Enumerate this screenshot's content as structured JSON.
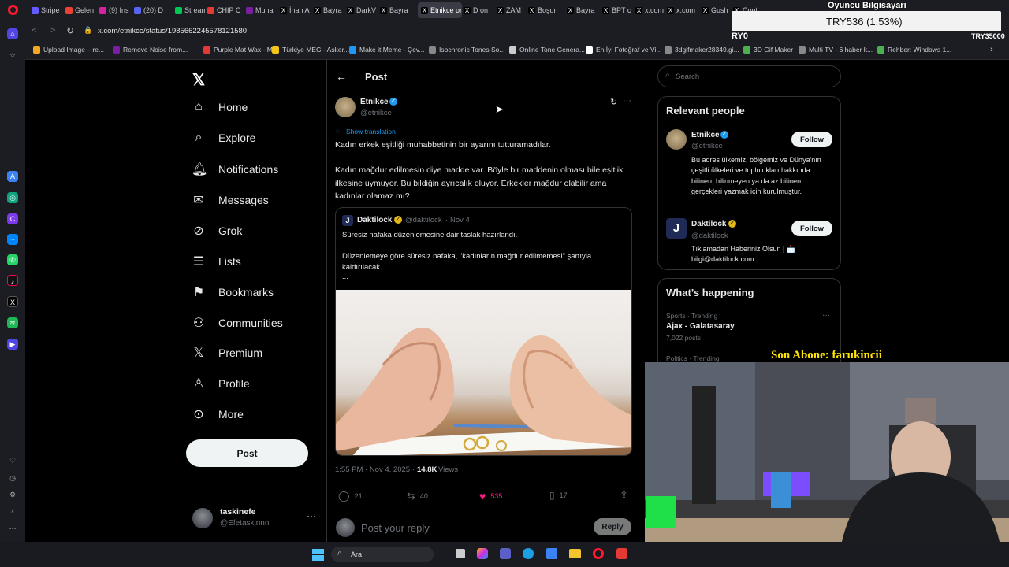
{
  "browser": {
    "tabs": [
      {
        "label": "Stripe",
        "color": "#635bff"
      },
      {
        "label": "Gelen",
        "color": "#ea4335"
      },
      {
        "label": "(9) Ins",
        "color": "#d6249f"
      },
      {
        "label": "(20) D",
        "color": "#5865f2"
      },
      {
        "label": "Stream",
        "color": "#00c853"
      },
      {
        "label": "CHIP C",
        "color": "#e53935"
      },
      {
        "label": "Muha",
        "color": "#7b1fa2"
      },
      {
        "label": "İnan A",
        "color": "#000000"
      },
      {
        "label": "Bayra",
        "color": "#000000"
      },
      {
        "label": "DarkV",
        "color": "#000000"
      },
      {
        "label": "Bayra",
        "color": "#000000"
      },
      {
        "label": "Etnikce on",
        "color": "#000000"
      },
      {
        "label": "D on",
        "color": "#000000"
      },
      {
        "label": "ZAM",
        "color": "#000000"
      },
      {
        "label": "Boşun",
        "color": "#000000"
      },
      {
        "label": "Bayra",
        "color": "#000000"
      },
      {
        "label": "BPT c",
        "color": "#000000"
      },
      {
        "label": "x.com",
        "color": "#000000"
      },
      {
        "label": "x.com",
        "color": "#000000"
      },
      {
        "label": "Gush",
        "color": "#000000"
      },
      {
        "label": "Confi",
        "color": "#000000"
      }
    ],
    "url": "x.com/etnikce/status/1985662245578121580",
    "bookmarks": [
      {
        "label": "Upload Image – re...",
        "color": "#f5a623"
      },
      {
        "label": "Remove Noise from...",
        "color": "#7b1fa2"
      },
      {
        "label": "Purple Mat Wax - M...",
        "color": "#e53935"
      },
      {
        "label": "Türkiye MEG - Asker...",
        "color": "#f5c518"
      },
      {
        "label": "Make it Meme - Çev...",
        "color": "#2196f3"
      },
      {
        "label": "Isochronic Tones So...",
        "color": "#888888"
      },
      {
        "label": "Online Tone Genera...",
        "color": "#cccccc"
      },
      {
        "label": "En İyi Fotoğraf ve Vi...",
        "color": "#ffffff"
      },
      {
        "label": "3dgifmaker28349.gi...",
        "color": "#888888"
      },
      {
        "label": "3D Gif Maker",
        "color": "#4caf50"
      },
      {
        "label": "Multi TV - 6 haber k...",
        "color": "#888888"
      },
      {
        "label": "Rehber: Windows 1...",
        "color": "#4caf50"
      }
    ],
    "overlay_top": {
      "title": "Oyuncu Bilgisayarı",
      "ticker": "TRY536 (1.53%)",
      "left_code": "RY0",
      "right_code": "TRY35000"
    }
  },
  "x": {
    "nav": [
      {
        "label": "Home",
        "icon": "home-icon"
      },
      {
        "label": "Explore",
        "icon": "search-icon"
      },
      {
        "label": "Notifications",
        "icon": "bell-icon"
      },
      {
        "label": "Messages",
        "icon": "mail-icon"
      },
      {
        "label": "Grok",
        "icon": "grok-icon"
      },
      {
        "label": "Lists",
        "icon": "list-icon"
      },
      {
        "label": "Bookmarks",
        "icon": "bookmark-icon"
      },
      {
        "label": "Communities",
        "icon": "people-icon"
      },
      {
        "label": "Premium",
        "icon": "x-icon"
      },
      {
        "label": "Profile",
        "icon": "person-icon"
      },
      {
        "label": "More",
        "icon": "more-icon"
      }
    ],
    "post_button": "Post",
    "account": {
      "name": "taskinefe",
      "handle": "@Efetaskinnn"
    },
    "header_title": "Post",
    "post": {
      "author": "Etnikce",
      "handle": "@etnikce",
      "show_translation": "Show translation",
      "text1": "Kadın erkek eşitliği muhabbetinin bir ayarını tutturamadılar.",
      "text2": "Kadın mağdur edilmesin diye madde var. Böyle bir maddenin olması bile eşitlik ilkesine uymuyor. Bu bildiğin ayrıcalık oluyor. Erkekler mağdur olabilir ama kadınlar olamaz mı?",
      "quote": {
        "author": "Daktilock",
        "handle": "@daktilock",
        "date": "Nov 4",
        "line1": "Süresiz nafaka düzenlemesine dair taslak hazırlandı.",
        "line2": "Düzenlemeye göre süresiz nafaka, \"kadınların mağdur edilmemesi\" şartıyla kaldırılacak.",
        "ellipsis": "..."
      },
      "time": "1:55 PM · Nov 4, 2025 ·",
      "views_count": "14.8K",
      "views_label": "Views",
      "replies": "21",
      "reposts": "40",
      "likes": "535",
      "bookmarks": "17",
      "reply_placeholder": "Post your reply",
      "reply_button": "Reply"
    },
    "search_placeholder": "Search",
    "relevant": {
      "title": "Relevant people",
      "people": [
        {
          "name": "Etnikce",
          "handle": "@etnikce",
          "bio": "Bu adres ülkemiz, bölgemiz ve Dünya'nın çeşitli ülkeleri ve toplulukları hakkında bilinen, bilinmeyen ya da az bilinen gerçekleri yazmak için kurulmuştur.",
          "follow": "Follow"
        },
        {
          "name": "Daktilock",
          "handle": "@daktilock",
          "bio": "Tıklamadan Haberiniz Olsun | 📩 bilgi@daktilock.com",
          "follow": "Follow"
        }
      ]
    },
    "happening": {
      "title": "What’s happening",
      "items": [
        {
          "category": "Sports · Trending",
          "topic": "Ajax - Galatasaray",
          "posts": "7,022 posts"
        },
        {
          "category": "Politics · Trending"
        }
      ]
    }
  },
  "stream": {
    "subscriber": "Son Abone: farukincii"
  },
  "taskbar": {
    "search": "Ara"
  },
  "colors": {
    "accent": "#1d9bf0",
    "like": "#f91880",
    "bg": "#000000",
    "border": "#2f3336",
    "muted": "#71767b"
  }
}
